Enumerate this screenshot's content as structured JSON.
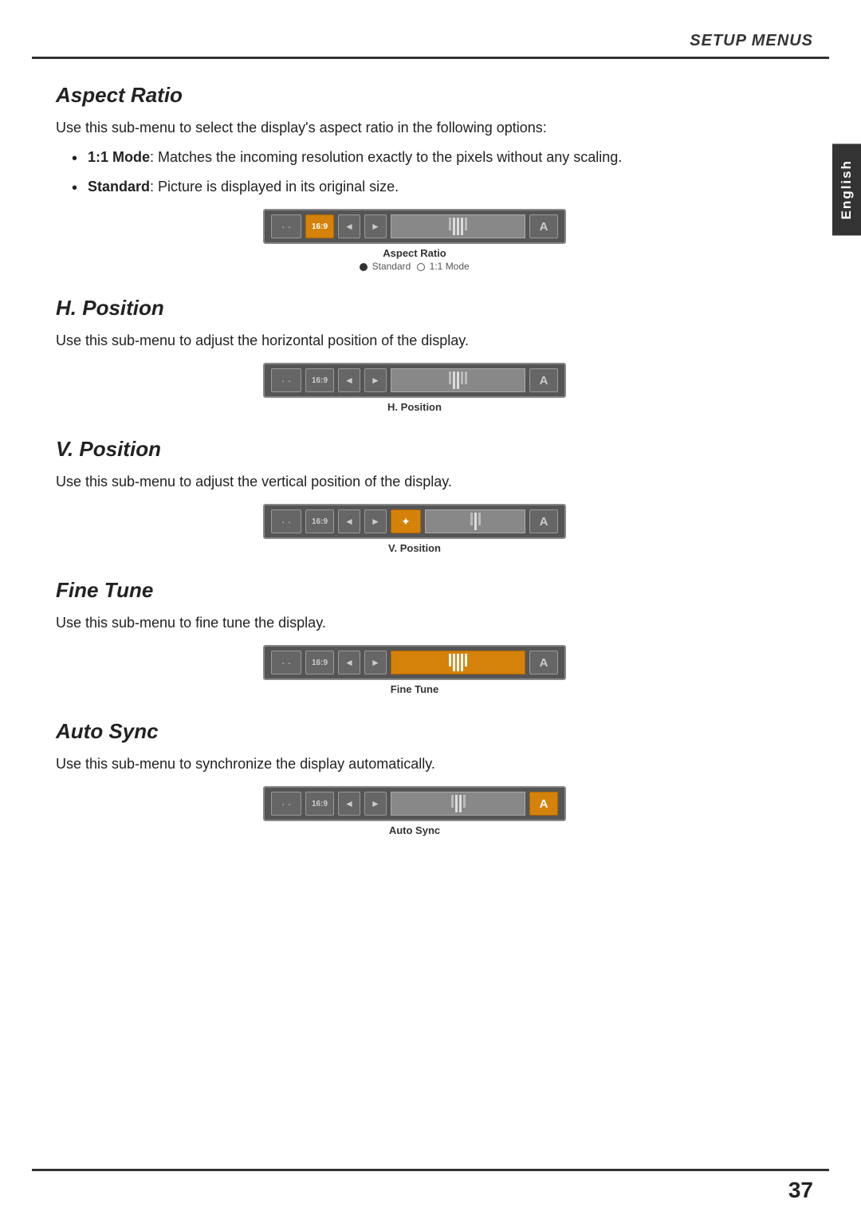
{
  "header": {
    "setup_menus": "SETUP MENUS"
  },
  "english_tab": "English",
  "sections": {
    "aspect_ratio": {
      "title": "Aspect Ratio",
      "description": "Use this sub-menu to select the display's aspect ratio in the following options:",
      "bullets": [
        {
          "term": "1:1 Mode",
          "text": ": Matches the incoming resolution exactly to the pixels without any scaling."
        },
        {
          "term": "Standard",
          "text": ": Picture is displayed in its original size."
        }
      ],
      "osd_label": "Aspect Ratio",
      "osd_sublabel_standard": "Standard",
      "osd_sublabel_11mode": "1:1 Mode",
      "ratio_text": "16:9"
    },
    "h_position": {
      "title": "H. Position",
      "description": "Use this sub-menu to adjust the horizontal position of the display.",
      "osd_label": "H. Position",
      "ratio_text": "16:9"
    },
    "v_position": {
      "title": "V. Position",
      "description": "Use this sub-menu to adjust the vertical position of the display.",
      "osd_label": "V. Position",
      "ratio_text": "16:9"
    },
    "fine_tune": {
      "title": "Fine Tune",
      "description": "Use this sub-menu to fine tune the display.",
      "osd_label": "Fine Tune",
      "ratio_text": "16:9"
    },
    "auto_sync": {
      "title": "Auto Sync",
      "description": "Use this sub-menu to synchronize the display automatically.",
      "osd_label": "Auto Sync",
      "ratio_text": "16:9"
    }
  },
  "page_number": "37",
  "symbols": {
    "dots_icon": "· ·",
    "nav_left": "◄",
    "nav_right": "►",
    "nav_up": "▲",
    "nav_down": "▼",
    "letter_a": "A",
    "ratio": "16:9",
    "asterisk": "✦"
  }
}
